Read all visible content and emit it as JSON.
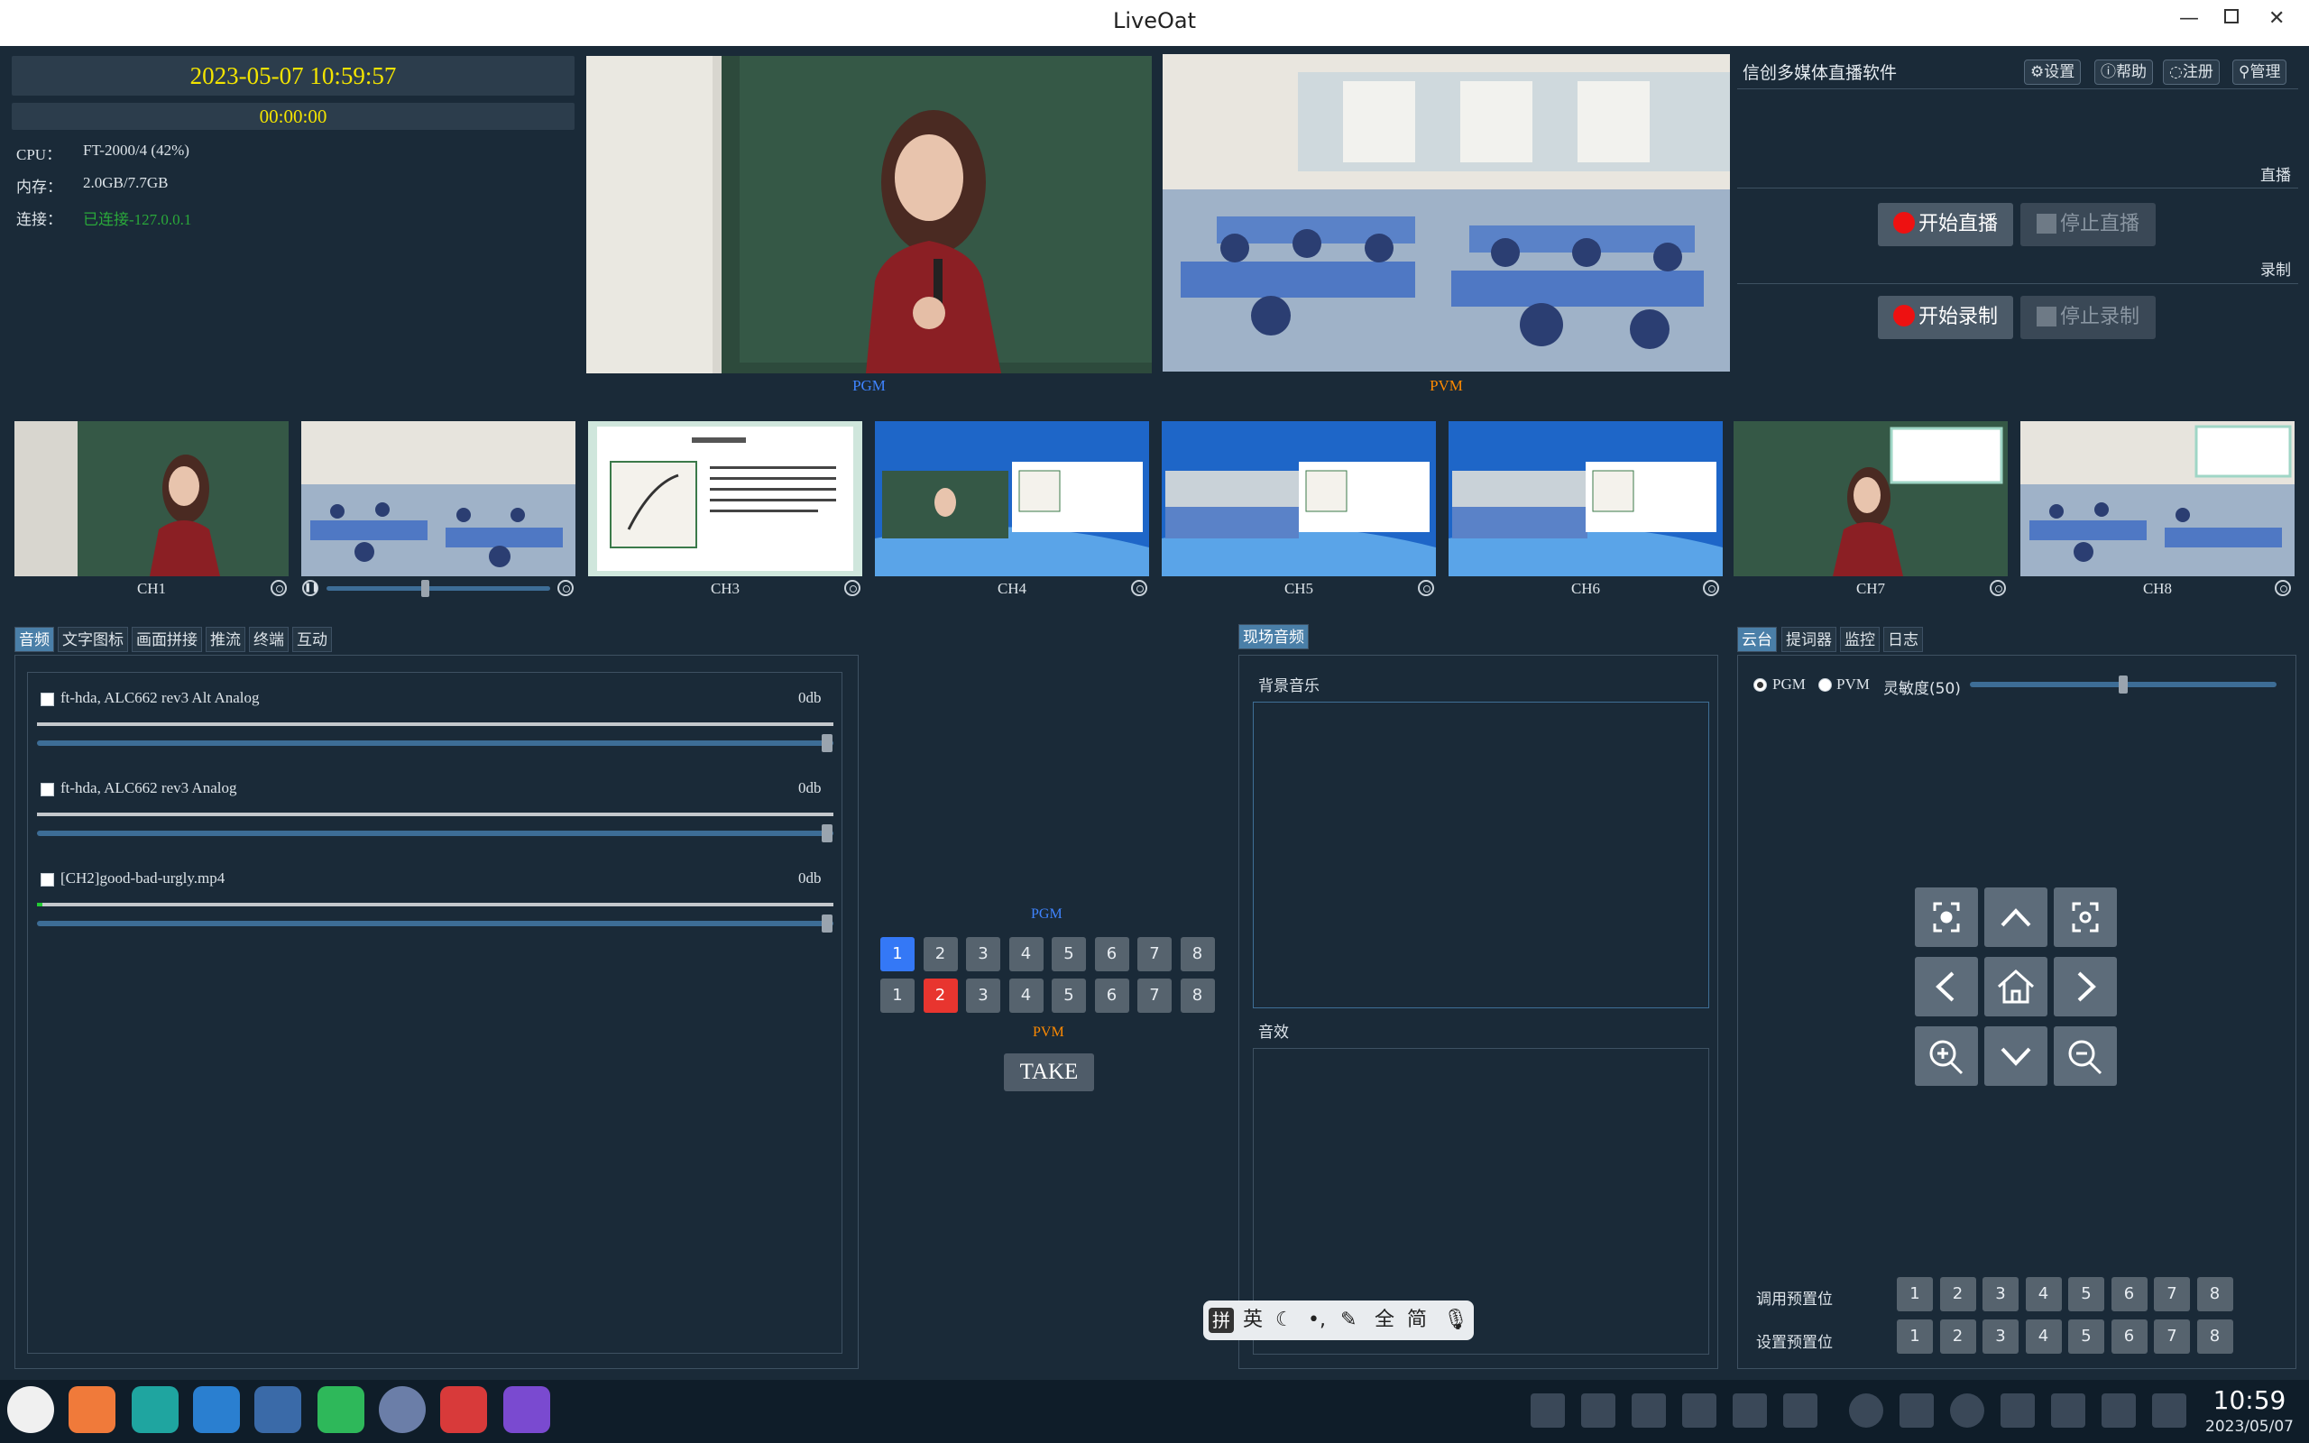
{
  "window": {
    "title": "LiveOat"
  },
  "status": {
    "datetime": "2023-05-07 10:59:57",
    "timer": "00:00:00",
    "cpu_label": "CPU：",
    "cpu_value": "FT-2000/4 (42%)",
    "mem_label": "内存：",
    "mem_value": "2.0GB/7.7GB",
    "conn_label": "连接：",
    "conn_value": "已连接-127.0.0.1",
    "colors": {
      "datetime": "#f3e400",
      "connected": "#2aa83a"
    }
  },
  "preview": {
    "pgm_label": "PGM",
    "pvm_label": "PVM",
    "colors": {
      "pgm": "#3f84ff",
      "pvm": "#ff8a00"
    }
  },
  "header": {
    "app_name": "信创多媒体直播软件",
    "tools": [
      {
        "label": "设置",
        "icon": "gear-icon"
      },
      {
        "label": "帮助",
        "icon": "help-icon"
      },
      {
        "label": "注册",
        "icon": "register-icon"
      },
      {
        "label": "管理",
        "icon": "manage-icon"
      }
    ]
  },
  "live": {
    "section": "直播",
    "start": "开始直播",
    "stop": "停止直播"
  },
  "record": {
    "section": "录制",
    "start": "开始录制",
    "stop": "停止录制"
  },
  "channels": [
    "CH1",
    "",
    "CH3",
    "CH4",
    "CH5",
    "CH6",
    "CH7",
    "CH8"
  ],
  "ch2_volume": 0.44,
  "left_tabs": [
    "音频",
    "文字图标",
    "画面拼接",
    "推流",
    "终端",
    "互动"
  ],
  "audio": [
    {
      "name": "ft-hda, ALC662 rev3 Alt Analog",
      "db": "0db",
      "level": 0,
      "volume": 1.0
    },
    {
      "name": "ft-hda, ALC662 rev3 Analog",
      "db": "0db",
      "level": 0,
      "volume": 1.0
    },
    {
      "name": "[CH2]good-bad-urgly.mp4",
      "db": "0db",
      "level": 0.01,
      "volume": 1.0
    }
  ],
  "switcher": {
    "pgm_label": "PGM",
    "pvm_label": "PVM",
    "numbers": [
      "1",
      "2",
      "3",
      "4",
      "5",
      "6",
      "7",
      "8"
    ],
    "pgm_selected": 1,
    "pvm_selected": 2,
    "take": "TAKE"
  },
  "scene_audio": {
    "tab": "现场音频",
    "bgm": "背景音乐",
    "sfx": "音效"
  },
  "right_tabs": [
    "云台",
    "提词器",
    "监控",
    "日志"
  ],
  "ptz": {
    "pgm": "PGM",
    "pvm": "PVM",
    "selected": "PGM",
    "sensitivity_label": "灵敏度(50)",
    "sensitivity": 50,
    "call_preset": "调用预置位",
    "set_preset": "设置预置位",
    "presets": [
      "1",
      "2",
      "3",
      "4",
      "5",
      "6",
      "7",
      "8"
    ]
  },
  "ime": {
    "items": [
      "拼",
      "英",
      "全",
      "简"
    ]
  },
  "taskbar": {
    "time": "10:59",
    "date": "2023/05/07"
  }
}
